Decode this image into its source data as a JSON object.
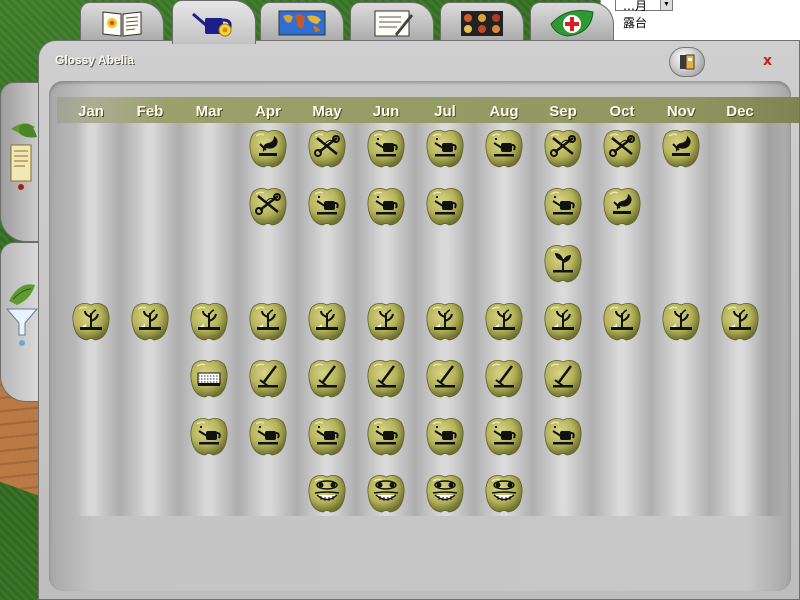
{
  "window": {
    "title": "Glossy Abelia",
    "close_label": "x"
  },
  "background": {
    "right_text_1": "…月",
    "right_text_2": "露台"
  },
  "top_tabs": [
    {
      "name": "tab-encyclopedia",
      "icon": "open-book-icon",
      "active": false
    },
    {
      "name": "tab-garden-care",
      "icon": "watering-can-icon",
      "active": true
    },
    {
      "name": "tab-world-map",
      "icon": "world-map-icon",
      "active": false
    },
    {
      "name": "tab-notes",
      "icon": "notepad-pen-icon",
      "active": false
    },
    {
      "name": "tab-plant-gallery",
      "icon": "photo-grid-icon",
      "active": false
    },
    {
      "name": "tab-plant-doctor",
      "icon": "red-cross-leaf-icon",
      "active": false
    }
  ],
  "side_tabs": [
    {
      "name": "side-tab-plant-info",
      "icon": "leaf-scroll-icon"
    },
    {
      "name": "side-tab-care",
      "icon": "leaf-funnel-icon"
    }
  ],
  "months": [
    "Jan",
    "Feb",
    "Mar",
    "Apr",
    "May",
    "Jun",
    "Jul",
    "Aug",
    "Sep",
    "Oct",
    "Nov",
    "Dec"
  ],
  "task_rows": [
    {
      "task": "planting",
      "icon": "planting-icon",
      "months": [
        3,
        9,
        10
      ]
    },
    {
      "task": "pruning",
      "icon": "shears-icon",
      "months": [
        4,
        5,
        8,
        9
      ]
    },
    {
      "task": "fertilizing",
      "icon": "watering-can-plus-icon",
      "months": [
        4,
        5,
        6,
        7,
        8
      ]
    },
    {
      "task": "transplanting",
      "icon": "seedling-icon",
      "months": [
        3,
        9
      ]
    },
    {
      "task": "mulching",
      "icon": "mulch-icon",
      "months": [
        2
      ]
    },
    {
      "task": "tending",
      "icon": "hand-rake-icon",
      "months": [
        3,
        4,
        5,
        6,
        7,
        8
      ]
    },
    {
      "task": "watering",
      "icon": "watering-can-plus-icon",
      "months": [
        2,
        3,
        4,
        5,
        6,
        7,
        8
      ]
    },
    {
      "task": "pest-check",
      "icon": "bug-face-icon",
      "months": [
        4,
        5,
        6,
        7
      ]
    }
  ],
  "grid_rows": [
    {
      "row": 0,
      "cells": [
        {
          "m": 3,
          "icon": "planting-icon"
        },
        {
          "m": 4,
          "icon": "shears-icon"
        },
        {
          "m": 5,
          "icon": "watering-can-plus-icon"
        },
        {
          "m": 6,
          "icon": "watering-can-plus-icon"
        },
        {
          "m": 7,
          "icon": "watering-can-plus-icon"
        },
        {
          "m": 8,
          "icon": "shears-icon"
        },
        {
          "m": 9,
          "icon": "shears-icon"
        },
        {
          "m": 10,
          "icon": "planting-icon"
        }
      ]
    },
    {
      "row": 1,
      "cells": [
        {
          "m": 3,
          "icon": "shears-icon"
        },
        {
          "m": 4,
          "icon": "watering-can-plus-icon"
        },
        {
          "m": 5,
          "icon": "watering-can-plus-icon"
        },
        {
          "m": 6,
          "icon": "watering-can-plus-icon"
        },
        {
          "m": 8,
          "icon": "watering-can-plus-icon"
        },
        {
          "m": 9,
          "icon": "planting-icon"
        }
      ]
    },
    {
      "row": 2,
      "cells": [
        {
          "m": 8,
          "icon": "seedling-icon"
        }
      ]
    },
    {
      "row": 3,
      "cells": [
        {
          "m": 0,
          "icon": "sprout-icon"
        },
        {
          "m": 1,
          "icon": "sprout-icon"
        },
        {
          "m": 2,
          "icon": "sprout-icon"
        },
        {
          "m": 3,
          "icon": "sprout-icon"
        },
        {
          "m": 4,
          "icon": "sprout-icon"
        },
        {
          "m": 5,
          "icon": "sprout-icon"
        },
        {
          "m": 6,
          "icon": "sprout-icon"
        },
        {
          "m": 7,
          "icon": "sprout-icon"
        },
        {
          "m": 8,
          "icon": "sprout-icon"
        },
        {
          "m": 9,
          "icon": "sprout-icon"
        },
        {
          "m": 10,
          "icon": "sprout-icon"
        },
        {
          "m": 11,
          "icon": "sprout-icon"
        }
      ]
    },
    {
      "row": 4,
      "cells": [
        {
          "m": 2,
          "icon": "mulch-icon"
        },
        {
          "m": 3,
          "icon": "hand-rake-icon"
        },
        {
          "m": 4,
          "icon": "hand-rake-icon"
        },
        {
          "m": 5,
          "icon": "hand-rake-icon"
        },
        {
          "m": 6,
          "icon": "hand-rake-icon"
        },
        {
          "m": 7,
          "icon": "hand-rake-icon"
        },
        {
          "m": 8,
          "icon": "hand-rake-icon"
        }
      ]
    },
    {
      "row": 5,
      "cells": [
        {
          "m": 2,
          "icon": "watering-can-plus-icon"
        },
        {
          "m": 3,
          "icon": "watering-can-plus-icon"
        },
        {
          "m": 4,
          "icon": "watering-can-plus-icon"
        },
        {
          "m": 5,
          "icon": "watering-can-plus-icon"
        },
        {
          "m": 6,
          "icon": "watering-can-plus-icon"
        },
        {
          "m": 7,
          "icon": "watering-can-plus-icon"
        },
        {
          "m": 8,
          "icon": "watering-can-plus-icon"
        }
      ]
    },
    {
      "row": 6,
      "cells": [
        {
          "m": 4,
          "icon": "bug-face-icon"
        },
        {
          "m": 5,
          "icon": "bug-face-icon"
        },
        {
          "m": 6,
          "icon": "bug-face-icon"
        },
        {
          "m": 7,
          "icon": "bug-face-icon"
        }
      ]
    }
  ],
  "colors": {
    "pepper_light": "#d9d487",
    "pepper_mid": "#b4b35a",
    "pepper_dark": "#6f7230",
    "month_bar": "#9aa16a",
    "close_red": "#c8201a"
  }
}
